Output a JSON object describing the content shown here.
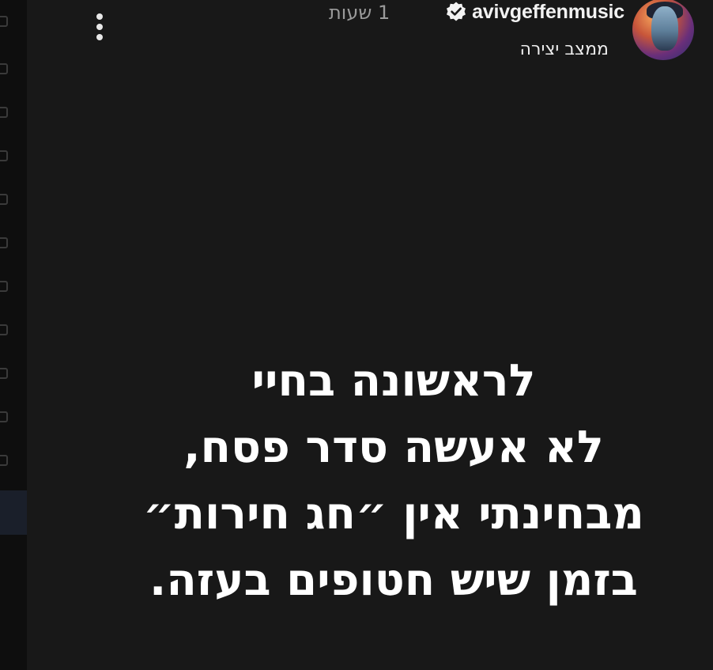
{
  "story": {
    "username": "avivgeffenmusic",
    "verified": true,
    "time_ago": "1 שעות",
    "subtitle": "ממצב יצירה",
    "text_lines": [
      "לראשונה בחיי",
      "לא אעשה סדר פסח,",
      "מבחינתי אין ״חג חירות״",
      "בזמן שיש חטופים בעזה."
    ]
  },
  "icons": {
    "more": "more-vertical-icon",
    "verified": "verified-badge-icon"
  },
  "colors": {
    "background": "#181818",
    "text": "#ffffff",
    "muted": "#9a9a9a"
  }
}
